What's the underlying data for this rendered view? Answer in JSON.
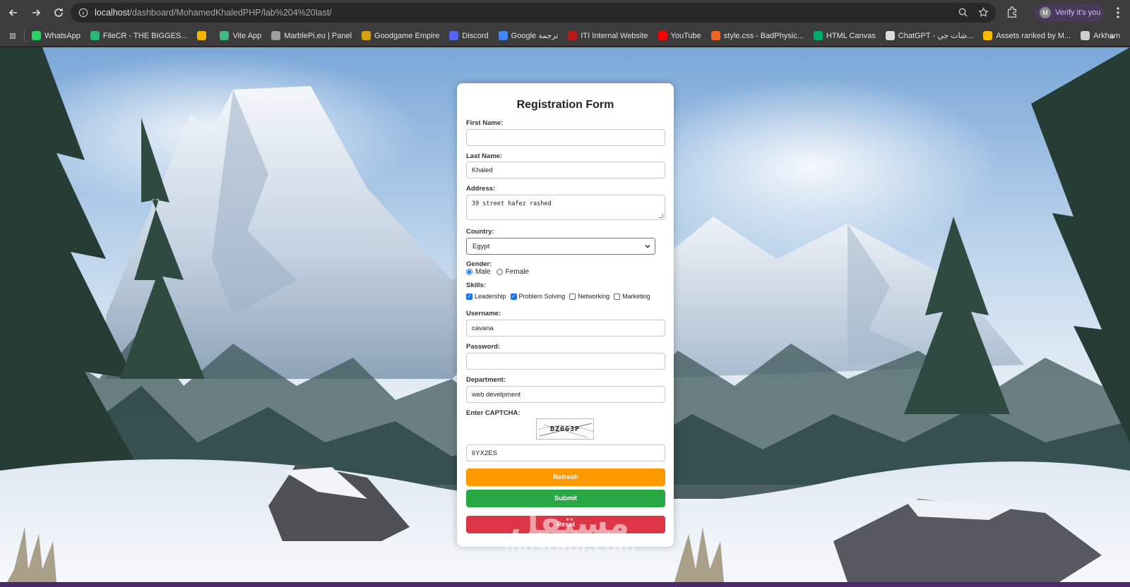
{
  "browser": {
    "url_host": "localhost",
    "url_path": "/dashboard/MohamedKhaledPHP/lab%204%20last/",
    "profile_initial": "M",
    "profile_chip": "Verify it's you",
    "bookmarks_more": "»",
    "bookmarks": [
      {
        "label": "WhatsApp",
        "color": "#25d366"
      },
      {
        "label": "FileCR - THE BIGGES...",
        "color": "#2bb673"
      },
      {
        "label": "",
        "color": "#f4b400"
      },
      {
        "label": "Vite App",
        "color": "#41b883"
      },
      {
        "label": "MarblePi.eu | Panel",
        "color": "#9e9e9e"
      },
      {
        "label": "Goodgame Empire",
        "color": "#d4a017"
      },
      {
        "label": "Discord",
        "color": "#5865f2"
      },
      {
        "label": "Google ترجمة",
        "color": "#4285f4"
      },
      {
        "label": "ITI Internal Website",
        "color": "#b71c1c"
      },
      {
        "label": "YouTube",
        "color": "#ff0000"
      },
      {
        "label": "style.css - BadPhysic...",
        "color": "#f26522"
      },
      {
        "label": "HTML Canvas",
        "color": "#04aa6d"
      },
      {
        "label": "ChatGPT - شات جي...",
        "color": "#dddddd"
      },
      {
        "label": "Assets ranked by M...",
        "color": "#fbbc04"
      },
      {
        "label": "Arkham",
        "color": "#cccccc"
      }
    ]
  },
  "form": {
    "title": "Registration Form",
    "first_name": {
      "label": "First Name:",
      "value": ""
    },
    "last_name": {
      "label": "Last Name:",
      "value": "Khaled"
    },
    "address": {
      "label": "Address:",
      "value": "39 street hafez rashed"
    },
    "country": {
      "label": "Country:",
      "value": "Egypt"
    },
    "gender": {
      "label": "Gender:",
      "options": [
        "Male",
        "Female"
      ],
      "selected": "Male"
    },
    "skills": {
      "label": "Skills:",
      "options": [
        {
          "label": "Leadership",
          "checked": true
        },
        {
          "label": "Problem Solving",
          "checked": true
        },
        {
          "label": "Networking",
          "checked": false
        },
        {
          "label": "Marketing",
          "checked": false
        }
      ]
    },
    "username": {
      "label": "Username:",
      "value": "cavana"
    },
    "password": {
      "label": "Password:",
      "value": ""
    },
    "department": {
      "label": "Department:",
      "value": "web develpment"
    },
    "captcha": {
      "label": "Enter CAPTCHA:",
      "image_text": "BZ0G3P",
      "value": "6YX2ES"
    },
    "buttons": {
      "refresh": {
        "label": "Refresh",
        "color": "#ff9900"
      },
      "submit": {
        "label": "Submit",
        "color": "#28a745"
      },
      "reset": {
        "label": "Reset",
        "color": "#dc3545"
      }
    }
  },
  "watermark": {
    "arabic": "مستقل",
    "latin": "mostaql.com"
  }
}
